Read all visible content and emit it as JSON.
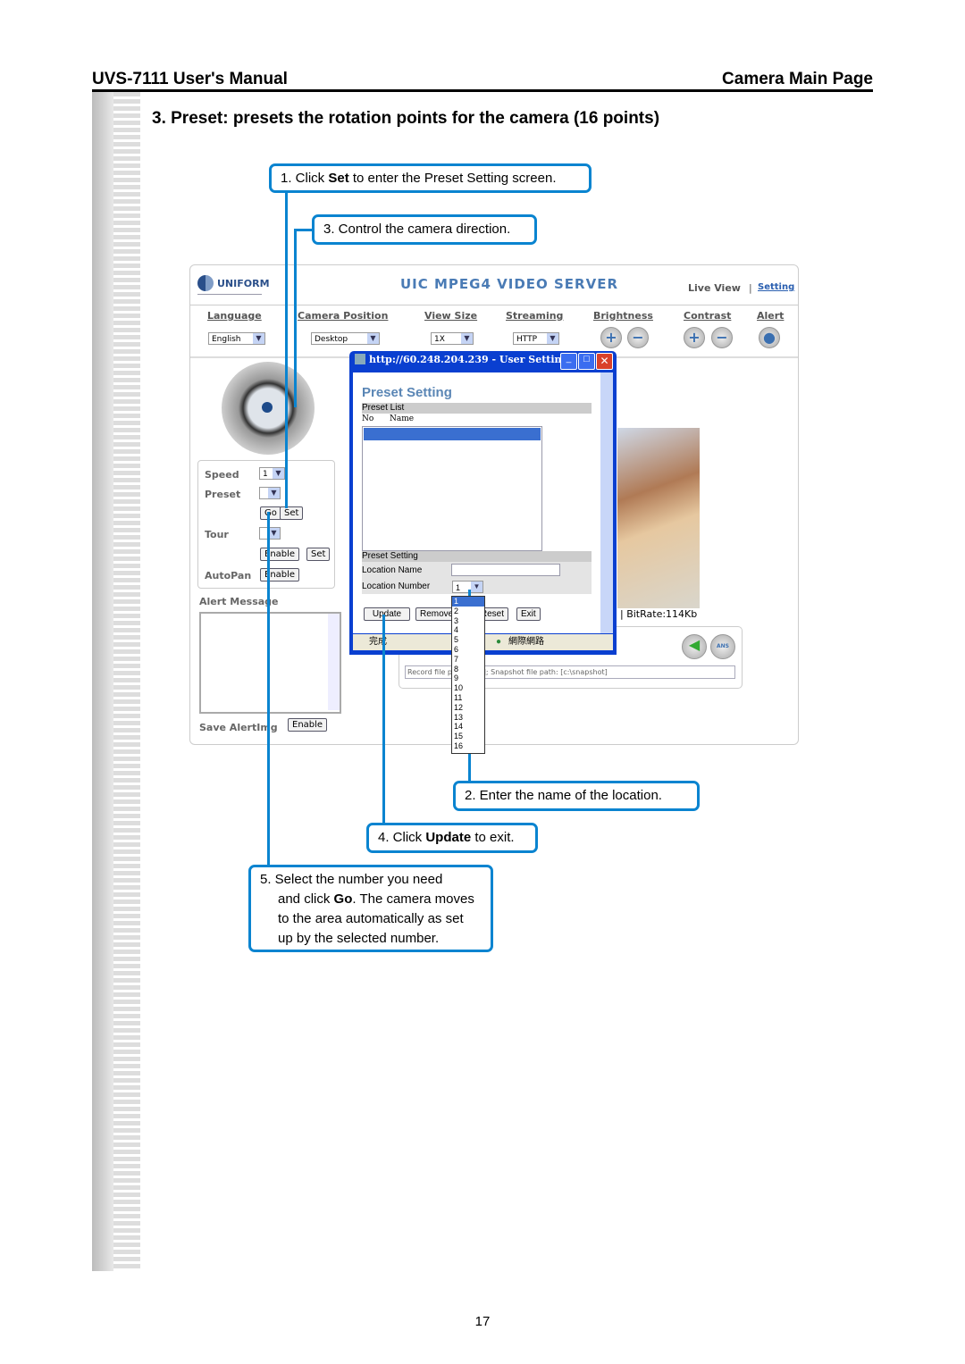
{
  "header": {
    "left": "UVS-7111 User's Manual",
    "right": "Camera Main Page"
  },
  "section_title": "3. Preset: presets the rotation points for the camera (16 points)",
  "callouts": {
    "c1": {
      "pre": "1. Click ",
      "bold": "Set",
      "post": " to enter the Preset Setting screen."
    },
    "c3": {
      "text": "3. Control the camera direction."
    },
    "c2": {
      "text": "2. Enter the name of the location."
    },
    "c4": {
      "pre": "4. Click ",
      "bold": "Update",
      "post": " to exit."
    },
    "c5": {
      "l1": "5. Select the number you need",
      "l2pre": "and click ",
      "l2bold": "Go",
      "l2post": ". The camera moves",
      "l3": "to the area automatically as set",
      "l4": "up by the selected number."
    }
  },
  "screenshot": {
    "logo": "UNIFORM",
    "app_title": "UIC MPEG4 VIDEO SERVER",
    "live_view": "Live View",
    "sep": "|",
    "setting_link": "Setting",
    "nav": [
      {
        "label": "Language",
        "value": "English"
      },
      {
        "label": "Camera Position",
        "value": "Desktop"
      },
      {
        "label": "View Size",
        "value": "1X"
      },
      {
        "label": "Streaming",
        "value": "HTTP"
      },
      {
        "label": "Brightness"
      },
      {
        "label": "Contrast"
      },
      {
        "label": "Alert"
      }
    ],
    "panel": {
      "speed": "Speed",
      "speed_value": "1",
      "preset": "Preset",
      "go": "Go",
      "set": "Set",
      "tour": "Tour",
      "enable": "Enable",
      "autopan": "AutoPan",
      "alert_message": "Alert Message",
      "save_alert": "Save AlertImg"
    },
    "bitrate": "| BitRate:114Kb",
    "ans": "ANS",
    "path_text": "Record file p[c:\\video]; Snapshot file path: [c:\\snapshot]",
    "popup": {
      "title": "http://60.248.204.239 - User Setting - ...",
      "heading": "Preset Setting",
      "list_header": "Preset List",
      "col_no": "No",
      "col_name": "Name",
      "setting_header": "Preset Setting",
      "location_name": "Location Name",
      "location_name_value": "",
      "location_number": "Location Number",
      "location_number_value": "1",
      "buttons": [
        "Update",
        "Remove",
        "Reset",
        "Exit"
      ],
      "status_done": "完成",
      "status_zone": "網際網路",
      "options": [
        "1",
        "2",
        "3",
        "4",
        "5",
        "6",
        "7",
        "8",
        "9",
        "10",
        "11",
        "12",
        "13",
        "14",
        "15",
        "16"
      ]
    }
  },
  "page_number": "17"
}
